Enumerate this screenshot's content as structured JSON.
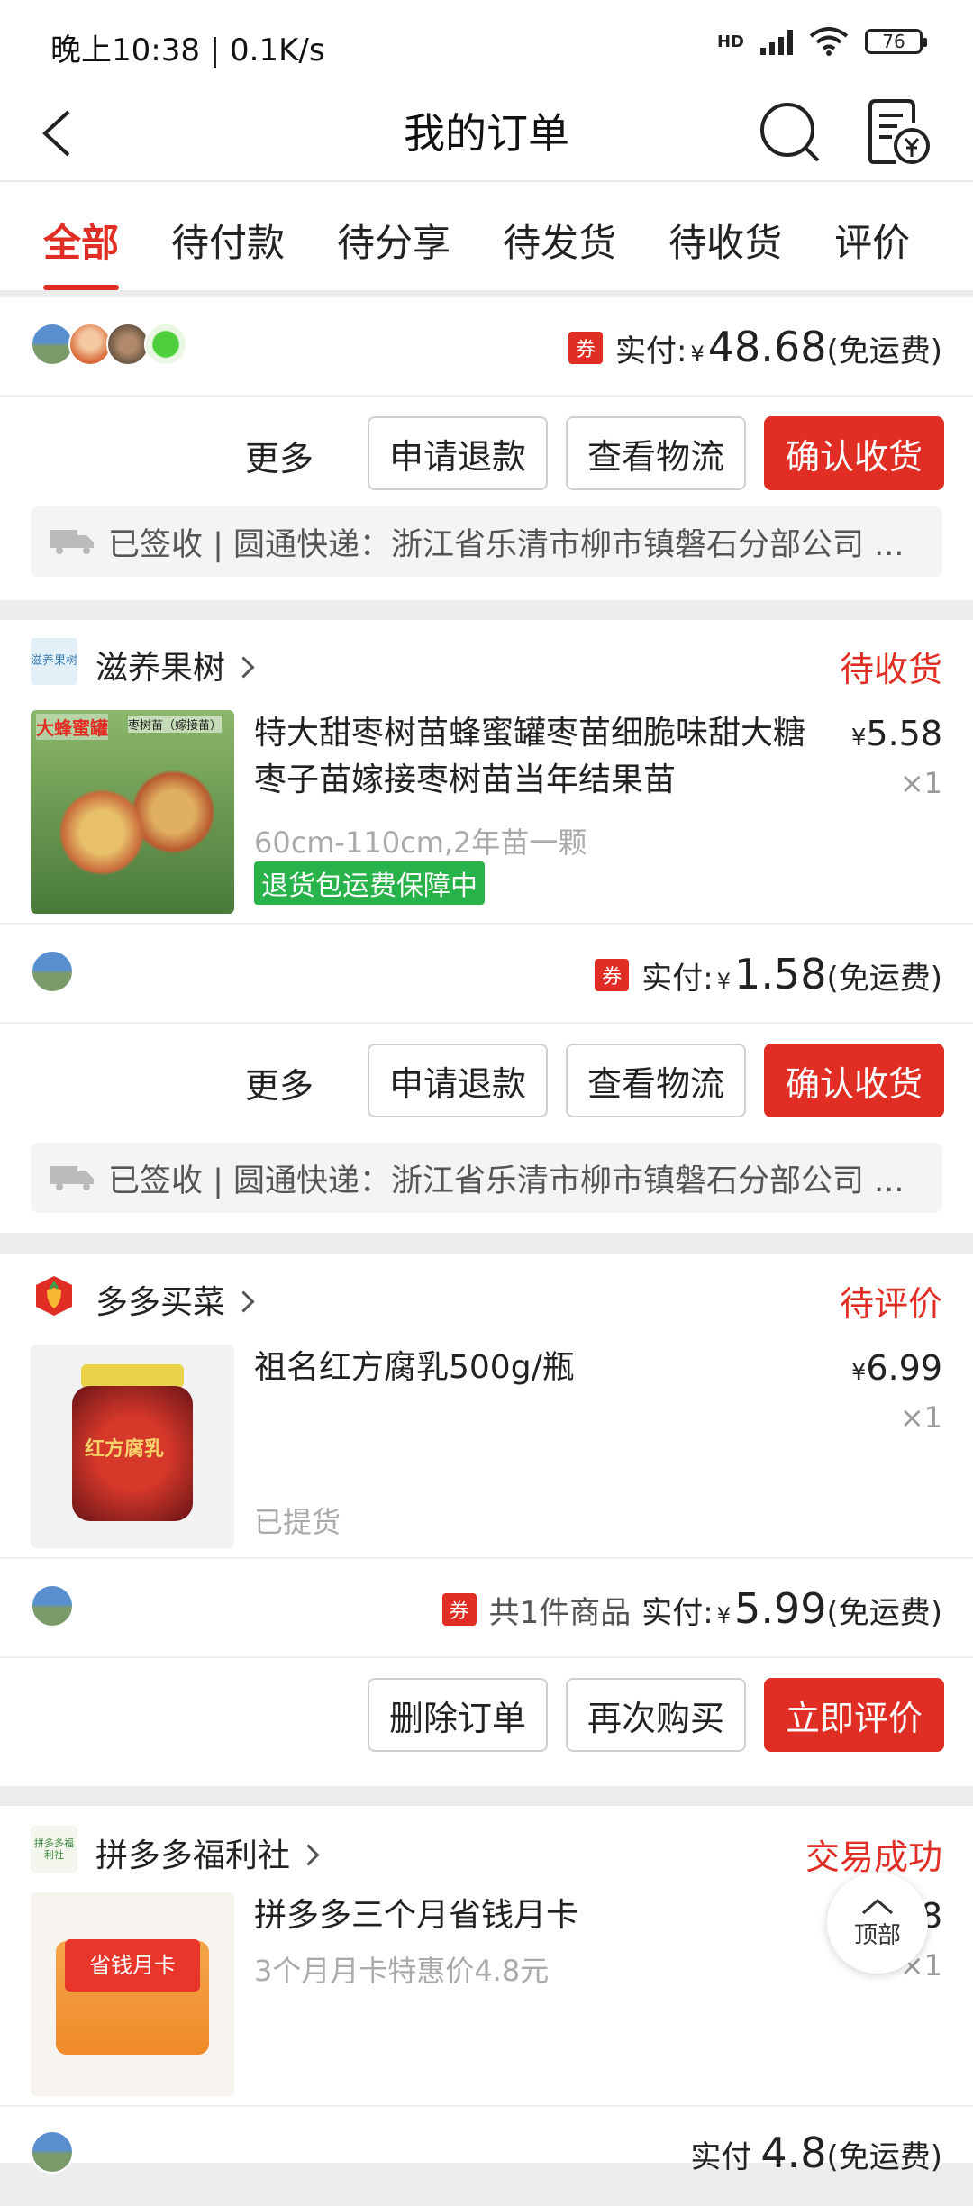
{
  "status_bar": {
    "time": "晚上10:38 | 0.1K/s",
    "network": "HD",
    "signal_sub": "4G",
    "battery": "76"
  },
  "nav": {
    "title": "我的订单"
  },
  "tabs": [
    "全部",
    "待付款",
    "待分享",
    "待发货",
    "待收货",
    "评价"
  ],
  "colors": {
    "accent": "#e02e24",
    "green_tag": "#28b24a"
  },
  "order1": {
    "coupon": "券",
    "paid_label": "实付:",
    "currency": "¥",
    "amount": "48.68",
    "shipping": "(免运费)",
    "more": "更多",
    "refund": "申请退款",
    "track": "查看物流",
    "confirm": "确认收货",
    "logistics": "已签收 | 圆通快递：浙江省乐清市柳市镇磐石分部公司 ..."
  },
  "order2": {
    "shop_logo_text": "滋养果树",
    "shop": "滋养果树",
    "status": "待收货",
    "thumb_text": "大蜂蜜罐",
    "thumb_sub": "枣树苗（嫁接苗）",
    "product": "特大甜枣树苗蜂蜜罐枣苗细脆味甜大糖枣子苗嫁接枣树苗当年结果苗",
    "price": "5.58",
    "qty": "×1",
    "spec": "60cm-110cm,2年苗一颗",
    "tag": "退货包运费保障中",
    "coupon": "券",
    "paid_label": "实付:",
    "currency": "¥",
    "amount": "1.58",
    "shipping": "(免运费)",
    "more": "更多",
    "refund": "申请退款",
    "track": "查看物流",
    "confirm": "确认收货",
    "logistics": "已签收 | 圆通快递：浙江省乐清市柳市镇磐石分部公司 ..."
  },
  "order3": {
    "shop": "多多买菜",
    "status": "待评价",
    "thumb_text": "红方腐乳",
    "product": "祖名红方腐乳500g/瓶",
    "price": "6.99",
    "qty": "×1",
    "spec": "已提货",
    "coupon": "券",
    "count": "共1件商品",
    "paid_label": "实付:",
    "currency": "¥",
    "amount": "5.99",
    "shipping": "(免运费)",
    "delete": "删除订单",
    "rebuy": "再次购买",
    "review": "立即评价"
  },
  "order4": {
    "shop_logo_text": "拼多多福利社",
    "shop": "拼多多福利社",
    "status": "交易成功",
    "thumb_text": "省钱月卡",
    "product": "拼多多三个月省钱月卡",
    "price_partial": "8",
    "qty": "×1",
    "spec": "3个月月卡特惠价4.8元",
    "paid_partial": "实付",
    "amount_partial": "4.8",
    "shipping_partial": "(免运费)"
  },
  "top_button": "顶部"
}
